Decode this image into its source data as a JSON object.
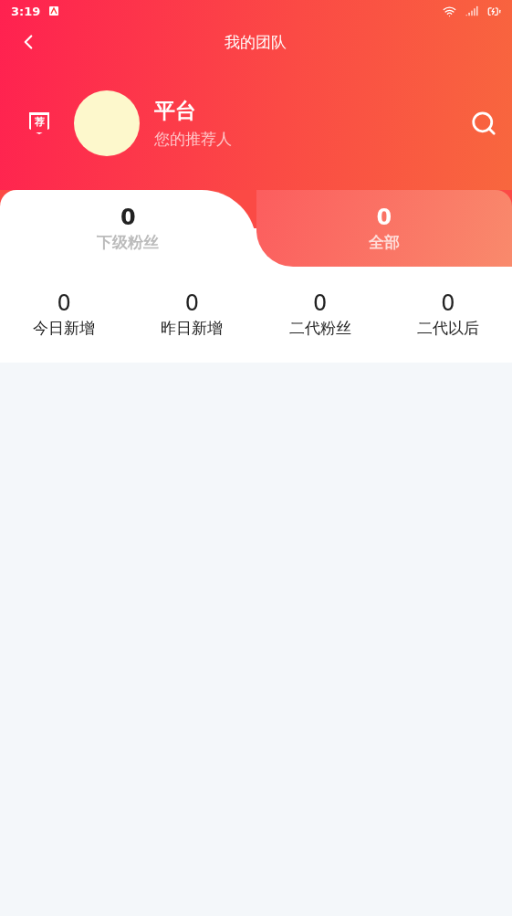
{
  "status_bar": {
    "time": "3:19"
  },
  "nav": {
    "title": "我的团队"
  },
  "profile": {
    "name": "平台",
    "subtitle": "您的推荐人",
    "badge": "荐"
  },
  "tabs": [
    {
      "count": "0",
      "label": "下级粉丝",
      "selected": true
    },
    {
      "count": "0",
      "label": "全部",
      "selected": false
    }
  ],
  "stats": [
    {
      "value": "0",
      "label": "今日新增"
    },
    {
      "value": "0",
      "label": "昨日新增"
    },
    {
      "value": "0",
      "label": "二代粉丝"
    },
    {
      "value": "0",
      "label": "二代以后"
    }
  ]
}
